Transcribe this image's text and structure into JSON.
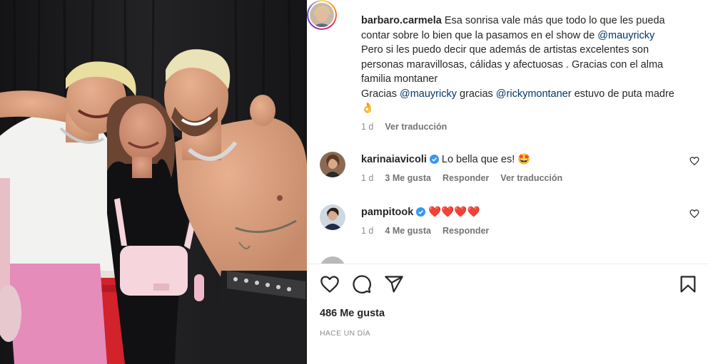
{
  "post": {
    "author": "barbaro.carmela",
    "caption_line1": "Esa sonrisa vale más que todo lo que les pueda contar sobre lo bien que la pasamos en el show de ",
    "mention1": "@mauyricky",
    "caption_line2": "Pero si les puedo decir que además de artistas excelentes son personas maravillosas, cálidas y afectuosas . Gracias con el alma familia montaner",
    "caption_line3a": "Gracias ",
    "mention2": "@mauyricky",
    "caption_line3b": " gracias ",
    "mention3": "@rickymontaner",
    "caption_line3c": " estuvo de puta madre ",
    "caption_emoji": "👌",
    "time": "1 d",
    "translate": "Ver traducción"
  },
  "comments": [
    {
      "user": "karinaiavicoli",
      "text": "Lo bella que es! 🤩",
      "time": "1 d",
      "likes": "3 Me gusta",
      "reply": "Responder",
      "translate": "Ver traducción"
    },
    {
      "user": "pampitook",
      "text": "❤️❤️❤️❤️",
      "time": "1 d",
      "likes": "4 Me gusta",
      "reply": "Responder"
    }
  ],
  "footer": {
    "likes": "486 Me gusta",
    "ago": "HACE UN DÍA"
  },
  "icons": {
    "like": "heart-icon",
    "comment": "comment-icon",
    "share": "send-icon",
    "save": "bookmark-icon",
    "verified": "verified-badge-icon"
  },
  "colors": {
    "mention": "#00376b",
    "verified": "#3897f0",
    "muted": "#8e8e8e"
  }
}
